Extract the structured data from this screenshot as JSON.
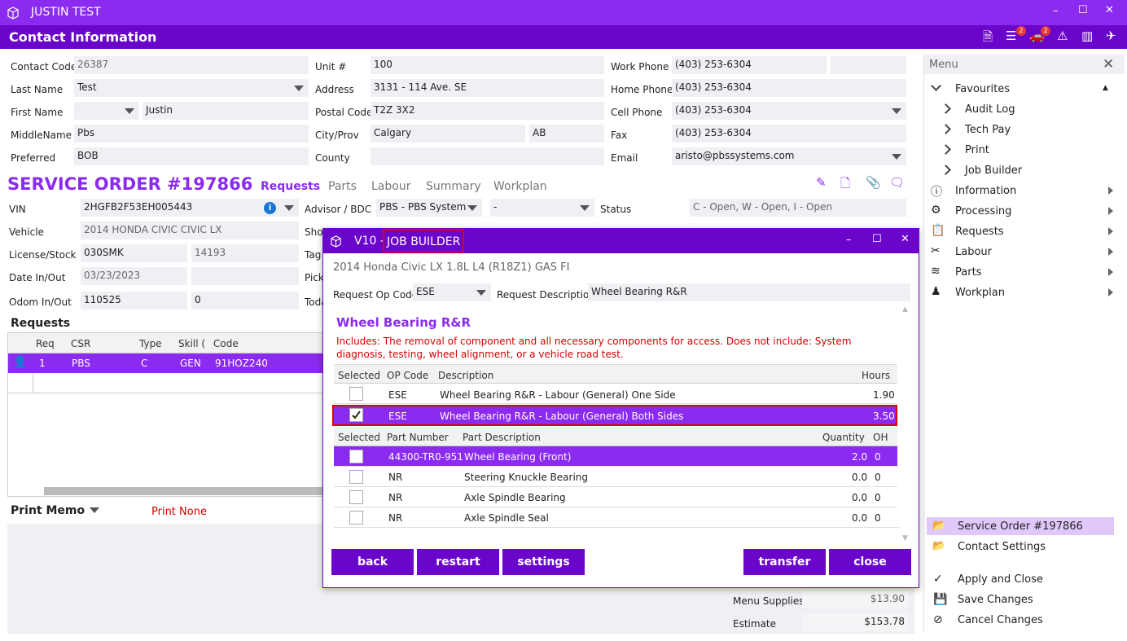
{
  "window": {
    "title": "JUSTIN TEST",
    "header": "Contact Information",
    "badge_a": "2",
    "badge_b": "2"
  },
  "contact": {
    "contact_code_label": "Contact Code",
    "contact_code": "26387",
    "last_name_label": "Last Name",
    "last_name": "Test",
    "first_name_label": "First Name",
    "first_name": "Justin",
    "middle_name_label": "MiddleName",
    "middle_name": "Pbs",
    "preferred_label": "Preferred",
    "preferred": "BOB",
    "unit_label": "Unit #",
    "unit": "100",
    "address_label": "Address",
    "address": "3131 - 114 Ave. SE",
    "postal_label": "Postal Code",
    "postal": "T2Z 3X2",
    "city_label": "City/Prov",
    "city": "Calgary",
    "prov": "AB",
    "county_label": "County",
    "county": "",
    "work_phone_label": "Work Phone",
    "work_phone": "(403) 253-6304",
    "home_phone_label": "Home Phone",
    "home_phone": "(403) 253-6304",
    "cell_phone_label": "Cell Phone",
    "cell_phone": "(403) 253-6304",
    "fax_label": "Fax",
    "fax": "(403) 253-6304",
    "email_label": "Email",
    "email": "aristo@pbssystems.com"
  },
  "service_order": {
    "title": "SERVICE ORDER #197866",
    "tabs": [
      "Requests",
      "Parts",
      "Labour",
      "Summary",
      "Workplan"
    ],
    "vin_label": "VIN",
    "vin": "2HGFB2F53EH005443",
    "vehicle_label": "Vehicle",
    "vehicle": "2014 HONDA CIVIC CIVIC LX",
    "license_label": "License/Stock",
    "license": "030SMK",
    "stock": "14193",
    "date_label": "Date In/Out",
    "date_in": "03/23/2023",
    "date_out": "",
    "odom_label": "Odom In/Out",
    "odom_in": "110525",
    "odom_out": "0",
    "advisor_label": "Advisor / BDC",
    "advisor": "PBS - PBS System",
    "bdc": "-",
    "status_label": "Status",
    "status": "C - Open, W - Open, I - Open",
    "cut_labels": [
      "Shop",
      "Tag",
      "Pick",
      "Toda"
    ]
  },
  "requests": {
    "title": "Requests",
    "columns": [
      "Req",
      "CSR",
      "Type",
      "Skill (",
      "Code"
    ],
    "rows": [
      {
        "req": "1",
        "csr": "PBS",
        "type": "C",
        "skill": "GEN",
        "code": "91HOZ240"
      }
    ]
  },
  "print_memo": {
    "label": "Print Memo",
    "value": "Print None"
  },
  "totals": {
    "menu_supplies_label": "Menu Supplies",
    "menu_supplies": "$13.90",
    "estimate_label": "Estimate",
    "estimate": "$153.78"
  },
  "menu": {
    "title": "Menu",
    "favourites": "Favourites",
    "fav_items": [
      "Audit Log",
      "Tech Pay",
      "Print",
      "Job Builder"
    ],
    "items": [
      "Information",
      "Processing",
      "Requests",
      "Labour",
      "Parts",
      "Workplan"
    ],
    "bottom": [
      "Service Order #197866",
      "Contact Settings"
    ],
    "actions": [
      "Apply and Close",
      "Save Changes",
      "Cancel Changes"
    ]
  },
  "dialog": {
    "title_prefix": "V10 - ",
    "title_main": "JOB BUILDER",
    "vehicle": "2014 Honda Civic LX 1.8L L4 (R18Z1) GAS FI",
    "op_code_label": "Request Op Code",
    "op_code": "ESE",
    "desc_label": "Request Description",
    "desc": "Wheel Bearing R&R",
    "job_title": "Wheel Bearing R&R",
    "includes": "Includes: The removal of component and all necessary components for access. Does not include: System diagnosis, testing, wheel alignment, or a vehicle road test.",
    "labour_cols": [
      "Selected",
      "OP Code",
      "Description",
      "Hours"
    ],
    "labour_rows": [
      {
        "op": "ESE",
        "desc": "Wheel Bearing R&R - Labour (General) One Side",
        "hours": "1.90",
        "checked": false
      },
      {
        "op": "ESE",
        "desc": "Wheel Bearing R&R - Labour (General) Both Sides",
        "hours": "3.50",
        "checked": true
      }
    ],
    "parts_cols": [
      "Selected",
      "Part Number",
      "Part Description",
      "Quantity",
      "OH"
    ],
    "parts_rows": [
      {
        "num": "44300-TR0-951",
        "desc": "Wheel Bearing (Front)",
        "qty": "2.0",
        "oh": "0"
      },
      {
        "num": "NR",
        "desc": "Steering Knuckle Bearing",
        "qty": "0.0",
        "oh": "0"
      },
      {
        "num": "NR",
        "desc": "Axle Spindle Bearing",
        "qty": "0.0",
        "oh": "0"
      },
      {
        "num": "NR",
        "desc": "Axle Spindle Seal",
        "qty": "0.0",
        "oh": "0"
      }
    ],
    "buttons": {
      "back": "back",
      "restart": "restart",
      "settings": "settings",
      "transfer": "transfer",
      "close": "close"
    }
  },
  "colors": {
    "title": "#8c2bf0",
    "header": "#6a06c9",
    "highlight": "#e10000",
    "accent_text": "#d40000"
  }
}
